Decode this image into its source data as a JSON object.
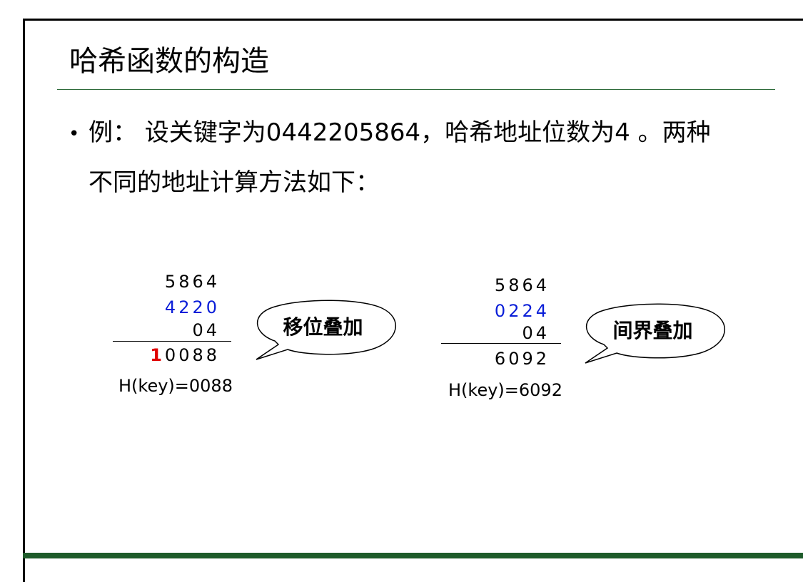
{
  "slide": {
    "title": "哈希函数的构造",
    "bullet_symbol": "•",
    "paragraph_line1": "例：  设关键字为0442205864，哈希地址位数为4 。两种",
    "paragraph_line2": "不同的地址计算方法如下："
  },
  "left_example": {
    "row1": "5864",
    "row2": "4220",
    "row3": "04",
    "carry": "1",
    "sum": "0088",
    "result": "H(key)=0088",
    "callout": "移位叠加"
  },
  "right_example": {
    "row1": "5864",
    "row2": "0224",
    "row3": "04",
    "sum": "6092",
    "result": "H(key)=6092",
    "callout": "间界叠加"
  },
  "colors": {
    "title_rule": "#2e6b3a",
    "bottom_bar": "#1e5b2a",
    "highlight_digits": "#0a1ed8",
    "carry_digit": "#e00000"
  }
}
